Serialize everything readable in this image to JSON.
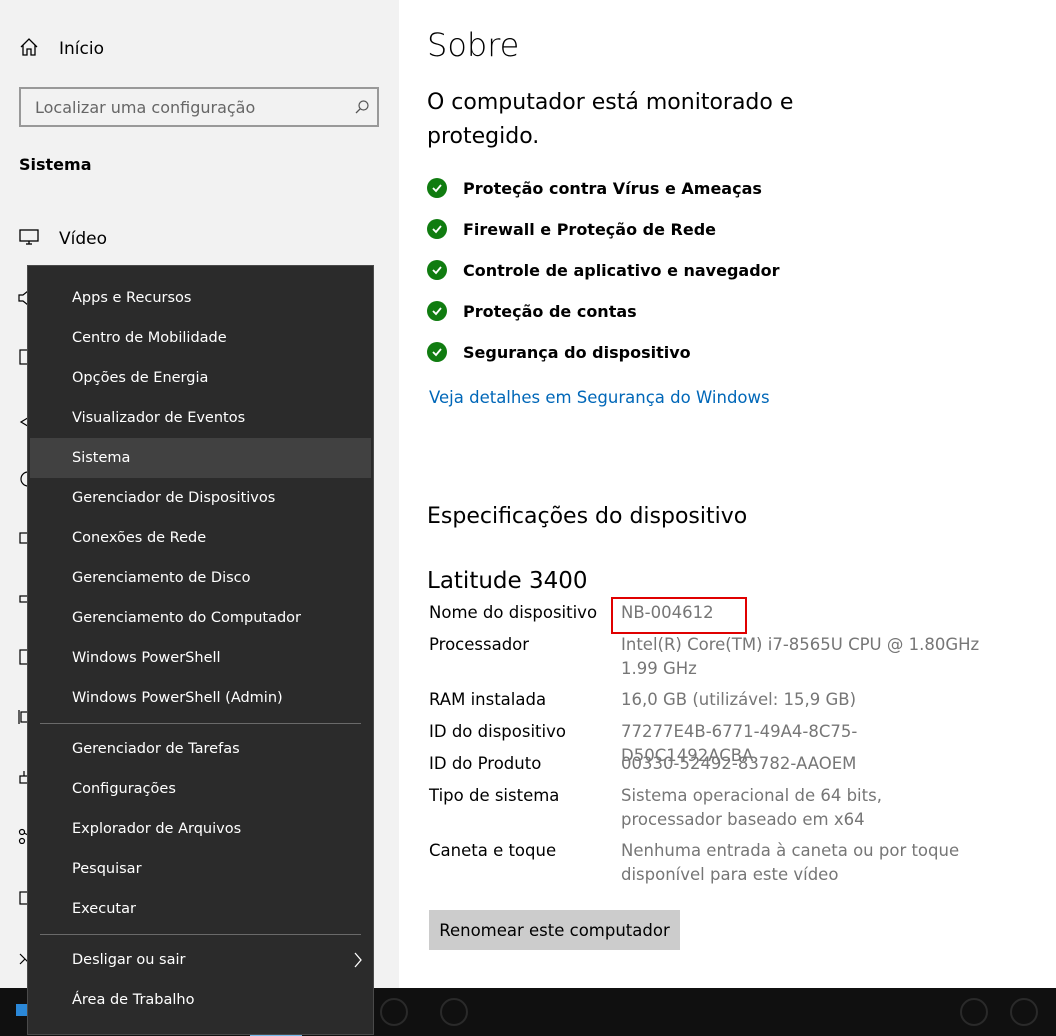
{
  "left": {
    "home_label": "Início",
    "search_placeholder": "Localizar uma configuração",
    "section_title": "Sistema",
    "nav_items": [
      {
        "label": "Vídeo",
        "icon": "monitor-icon"
      }
    ]
  },
  "context_menu": {
    "group1": [
      "Apps e Recursos",
      "Centro de Mobilidade",
      "Opções de Energia",
      "Visualizador de Eventos",
      "Sistema",
      "Gerenciador de Dispositivos",
      "Conexões de Rede",
      "Gerenciamento de Disco",
      "Gerenciamento do Computador",
      "Windows PowerShell",
      "Windows PowerShell (Admin)"
    ],
    "active_item": "Sistema",
    "group2": [
      "Gerenciador de Tarefas",
      "Configurações",
      "Explorador de Arquivos",
      "Pesquisar",
      "Executar"
    ],
    "group3": [
      "Desligar ou sair",
      "Área de Trabalho"
    ]
  },
  "about": {
    "title": "Sobre",
    "monitored": "O computador está monitorado e protegido.",
    "security_items": [
      "Proteção contra Vírus e Ameaças",
      "Firewall e Proteção de Rede",
      "Controle de aplicativo e navegador",
      "Proteção de contas",
      "Segurança do dispositivo"
    ],
    "security_link": "Veja detalhes em Segurança do Windows",
    "spec_title": "Especificações do dispositivo",
    "model": "Latitude 3400",
    "specs": [
      {
        "key": "Nome do dispositivo",
        "value": "NB-004612"
      },
      {
        "key": "Processador",
        "value": "Intel(R) Core(TM) i7-8565U CPU @ 1.80GHz 1.99 GHz"
      },
      {
        "key": "RAM instalada",
        "value": "16,0 GB (utilizável: 15,9 GB)"
      },
      {
        "key": "ID do dispositivo",
        "value": "77277E4B-6771-49A4-8C75-D50C1492ACBA"
      },
      {
        "key": "ID do Produto",
        "value": "00330-52492-83782-AAOEM"
      },
      {
        "key": "Tipo de sistema",
        "value": "Sistema operacional de 64 bits, processador baseado em x64"
      },
      {
        "key": "Caneta e toque",
        "value": "Nenhuma entrada à caneta ou por toque disponível para este vídeo"
      }
    ],
    "rename_button": "Renomear este computador"
  },
  "colors": {
    "accent": "#0067b8",
    "check_green": "#107c10",
    "highlight_red": "#e00000",
    "menu_bg": "#2b2b2b"
  }
}
